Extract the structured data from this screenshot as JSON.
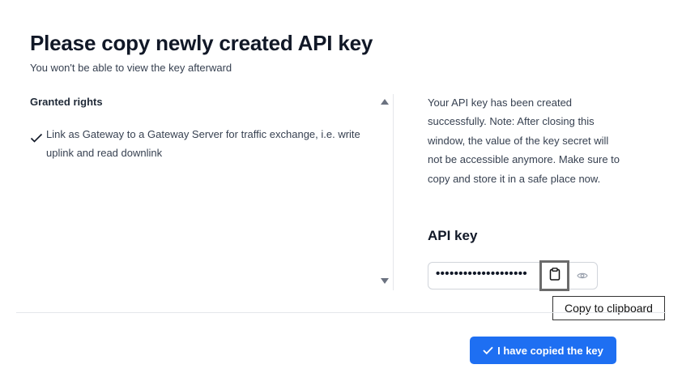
{
  "dialog": {
    "title": "Please copy newly created API key",
    "subtitle": "You won't be able to view the key afterward"
  },
  "rights": {
    "heading": "Granted rights",
    "items": [
      {
        "label": "Link as Gateway to a Gateway Server for traffic exchange, i.e. write uplink and read downlink",
        "icon": "checkmark-icon"
      }
    ]
  },
  "info": {
    "text": "Your API key has been created successfully. Note: After closing this window, the value of the key secret will not be accessible anymore. Make sure to copy and store it in a safe place now."
  },
  "api_key": {
    "heading": "API key",
    "masked_value": "••••••••••••••••••••",
    "copy_icon": "clipboard-icon",
    "reveal_icon": "eye-icon",
    "tooltip": "Copy to clipboard"
  },
  "footer": {
    "confirm_label": "I have copied the key",
    "confirm_icon": "checkmark-icon"
  },
  "colors": {
    "primary": "#1e6ff2",
    "text": "#374151"
  }
}
